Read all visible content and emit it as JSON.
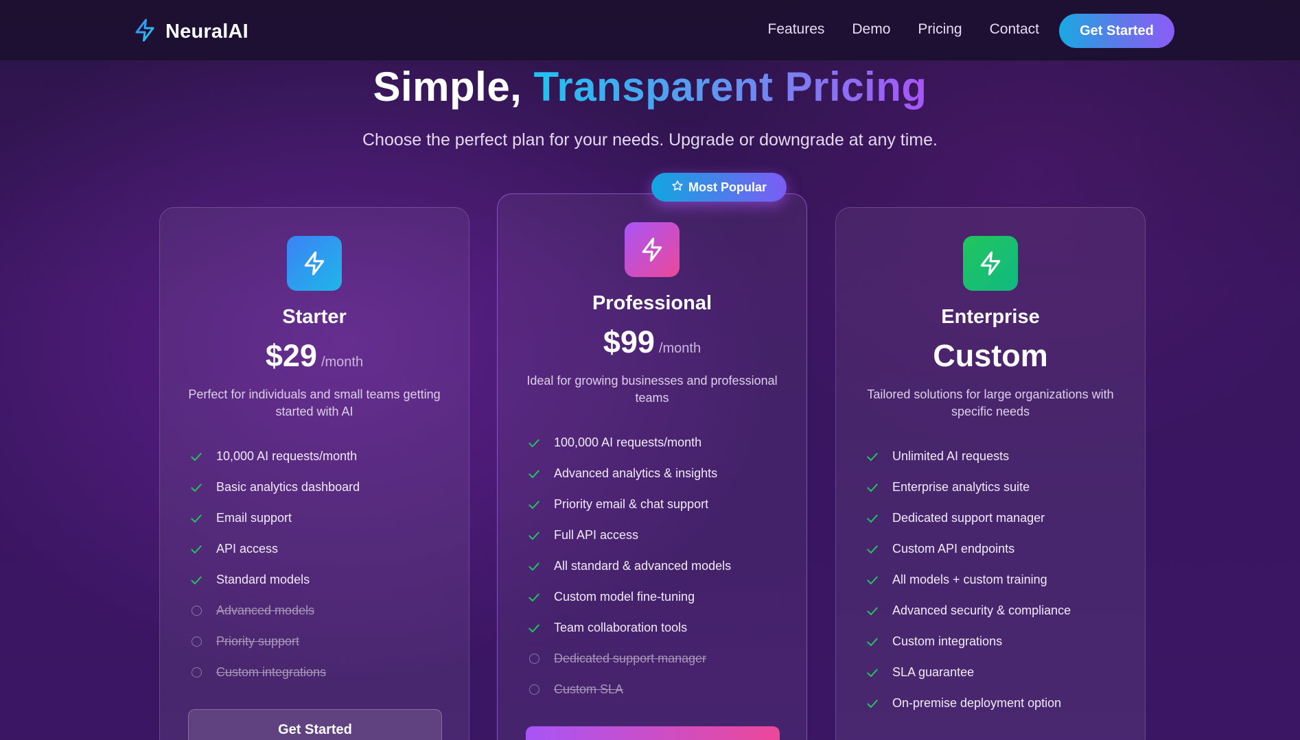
{
  "nav": {
    "brand": "NeuralAI",
    "links": [
      "Features",
      "Demo",
      "Pricing",
      "Contact"
    ],
    "cta": "Get Started"
  },
  "hero": {
    "title_plain": "Simple,",
    "title_gradient": "Transparent Pricing",
    "subtitle": "Choose the perfect plan for your needs. Upgrade or downgrade at any time."
  },
  "badge": {
    "label": "Most Popular",
    "icon": "star-icon"
  },
  "colors": {
    "accent_blue": "#19a9e3",
    "accent_purple": "#8b5cf6",
    "accent_pink": "#ec4899",
    "check_green": "#22c55e"
  },
  "plans": [
    {
      "name": "Starter",
      "price": "$29",
      "period": "/month",
      "description": "Perfect for individuals and small teams getting started with AI",
      "icon": "lightning-icon",
      "features": [
        {
          "text": "10,000 AI requests/month",
          "included": true
        },
        {
          "text": "Basic analytics dashboard",
          "included": true
        },
        {
          "text": "Email support",
          "included": true
        },
        {
          "text": "API access",
          "included": true
        },
        {
          "text": "Standard models",
          "included": true
        },
        {
          "text": "Advanced models",
          "included": false
        },
        {
          "text": "Priority support",
          "included": false
        },
        {
          "text": "Custom integrations",
          "included": false
        }
      ],
      "cta": "Get Started"
    },
    {
      "name": "Professional",
      "price": "$99",
      "period": "/month",
      "description": "Ideal for growing businesses and professional teams",
      "icon": "lightning-icon",
      "features": [
        {
          "text": "100,000 AI requests/month",
          "included": true
        },
        {
          "text": "Advanced analytics & insights",
          "included": true
        },
        {
          "text": "Priority email & chat support",
          "included": true
        },
        {
          "text": "Full API access",
          "included": true
        },
        {
          "text": "All standard & advanced models",
          "included": true
        },
        {
          "text": "Custom model fine-tuning",
          "included": true
        },
        {
          "text": "Team collaboration tools",
          "included": true
        },
        {
          "text": "Dedicated support manager",
          "included": false
        },
        {
          "text": "Custom SLA",
          "included": false
        }
      ],
      "cta": ""
    },
    {
      "name": "Enterprise",
      "price": "Custom",
      "description": "Tailored solutions for large organizations with specific needs",
      "icon": "lightning-icon",
      "features": [
        {
          "text": "Unlimited AI requests",
          "included": true
        },
        {
          "text": "Enterprise analytics suite",
          "included": true
        },
        {
          "text": "Dedicated support manager",
          "included": true
        },
        {
          "text": "Custom API endpoints",
          "included": true
        },
        {
          "text": "All models + custom training",
          "included": true
        },
        {
          "text": "Advanced security & compliance",
          "included": true
        },
        {
          "text": "Custom integrations",
          "included": true
        },
        {
          "text": "SLA guarantee",
          "included": true
        },
        {
          "text": "On-premise deployment option",
          "included": true
        }
      ]
    }
  ]
}
